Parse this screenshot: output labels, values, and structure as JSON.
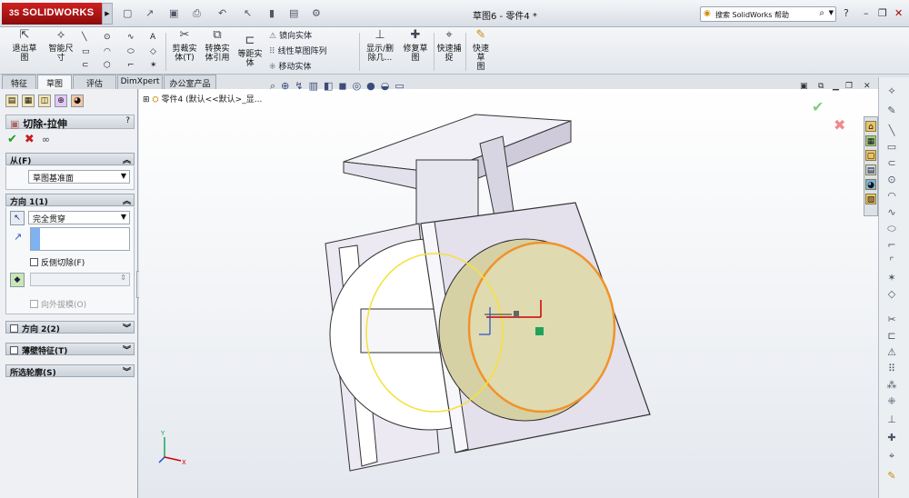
{
  "app": {
    "brand": "SOLIDWORKS",
    "ds_mark": "3S",
    "document_title": "草图6 - 零件4 *"
  },
  "search": {
    "placeholder": "搜索 SolidWorks 帮助"
  },
  "window_controls": {
    "help": "?",
    "minimize": "–",
    "restore": "❐",
    "close": "✕"
  },
  "ribbon": {
    "exit_sketch": "退出草\n图",
    "smart_dimension": "智能尺\n寸",
    "trim_entities": "剪裁实\n体(T)",
    "convert_entities": "转换实\n体引用",
    "offset_entities": "等距实\n体",
    "mirror_entities": "镜向实体",
    "linear_pattern": "线性草图阵列",
    "move_entities": "移动实体",
    "display_relations": "显示/删\n除几...",
    "repair_sketch": "修复草\n图",
    "quick_snaps": "快速捕\n捉",
    "rapid_sketch": "快速草\n图"
  },
  "tabs": [
    {
      "label": "特征",
      "active": false
    },
    {
      "label": "草图",
      "active": true
    },
    {
      "label": "评估",
      "active": false
    },
    {
      "label": "DimXpert",
      "active": false
    },
    {
      "label": "办公室产品",
      "active": false
    }
  ],
  "property_manager": {
    "title": "切除-拉伸",
    "help": "?",
    "from": {
      "header": "从(F)",
      "value": "草图基准面"
    },
    "direction1": {
      "header": "方向 1(1)",
      "end_condition": "完全贯穿",
      "flip_side": "反侧切除(F)",
      "draft_outward": "向外拔模(O)"
    },
    "direction2": "方向 2(2)",
    "thin_feature": "薄壁特征(T)",
    "selected_contours": "所选轮廓(S)"
  },
  "tree": {
    "label": "零件4 (默认<<默认>_显..."
  },
  "colors": {
    "accent": "#c41f1f",
    "ok": "#1b9a1b",
    "sketch_circle_yellow": "#f5e13a",
    "sketch_circle_orange": "#f0922b"
  }
}
